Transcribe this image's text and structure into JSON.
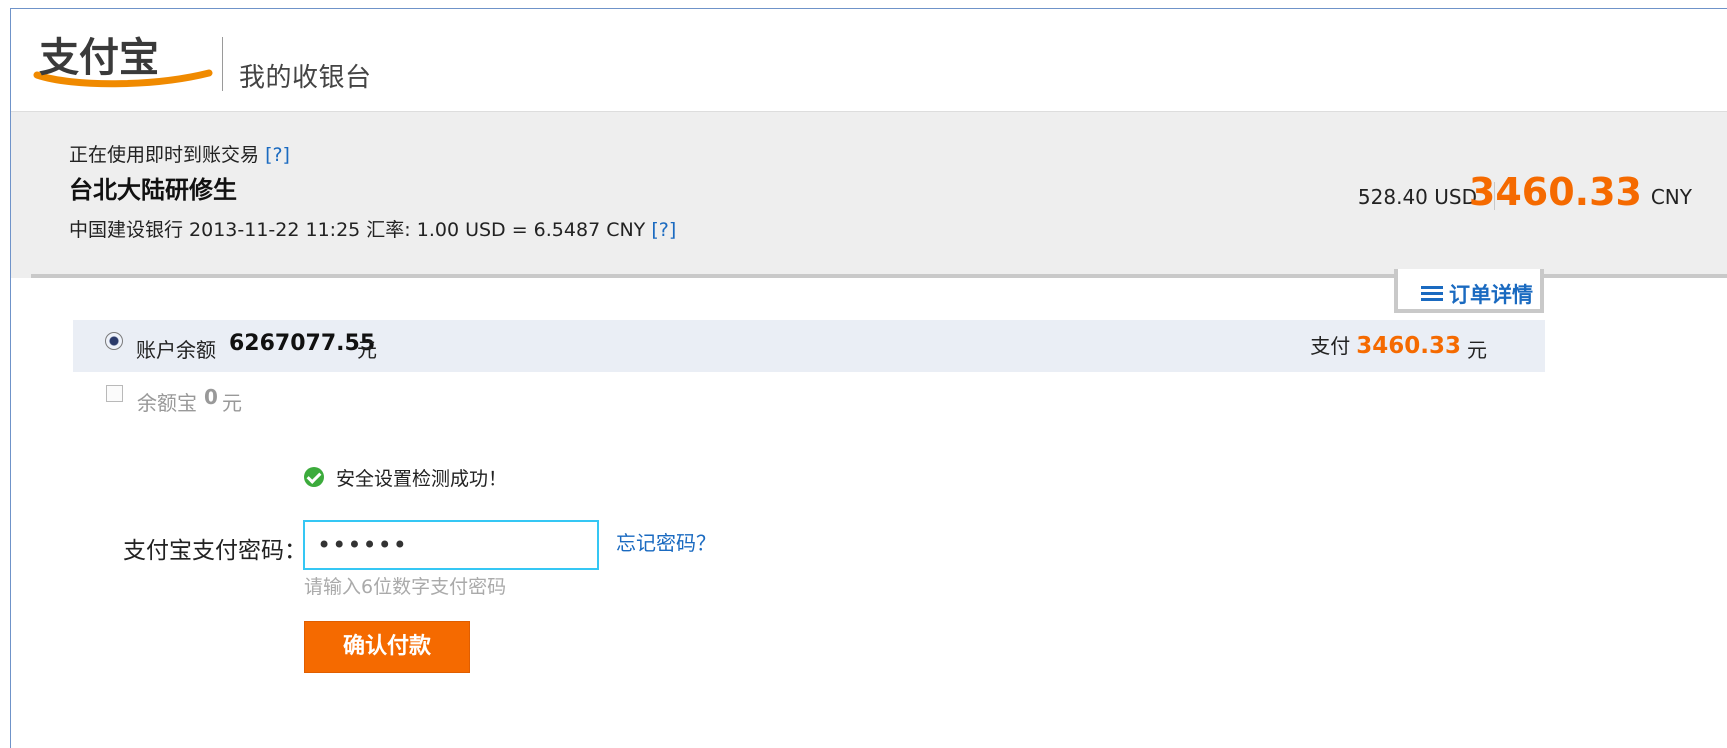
{
  "header": {
    "logo_text": "支付宝",
    "title": "我的收银台"
  },
  "order": {
    "mode_text": "正在使用即时到账交易",
    "help_label": "[?]",
    "merchant": "台北大陆研修生",
    "bank_line": "中国建设银行 2013-11-22 11:25 汇率: 1.00 USD = 6.5487 CNY",
    "amount_usd": "528.40 USD",
    "amount_cny": "3460.33",
    "currency": "CNY",
    "details_tab": "订单详情"
  },
  "payment": {
    "balance_label": "账户余额",
    "balance_amount": "6267077.55",
    "balance_unit": "元",
    "pay_label": "支付",
    "pay_amount": "3460.33",
    "pay_unit": "元",
    "yuebao_label": "余额宝",
    "yuebao_amount": "0",
    "yuebao_unit": "元"
  },
  "security": {
    "check_text": "安全设置检测成功！",
    "password_label": "支付宝支付密码：",
    "password_value": "••••••",
    "forgot_link": "忘记密码？",
    "hint": "请输入6位数字支付密码",
    "confirm_button": "确认付款"
  },
  "icons": {
    "check": "check-circle-icon",
    "list": "list-icon",
    "radio": "radio-selected",
    "checkbox": "checkbox-unchecked"
  },
  "colors": {
    "accent_orange": "#f56a00",
    "link_blue": "#1a6ac0",
    "focus_cyan": "#35c7f4",
    "band_gray": "#eeeeee"
  }
}
